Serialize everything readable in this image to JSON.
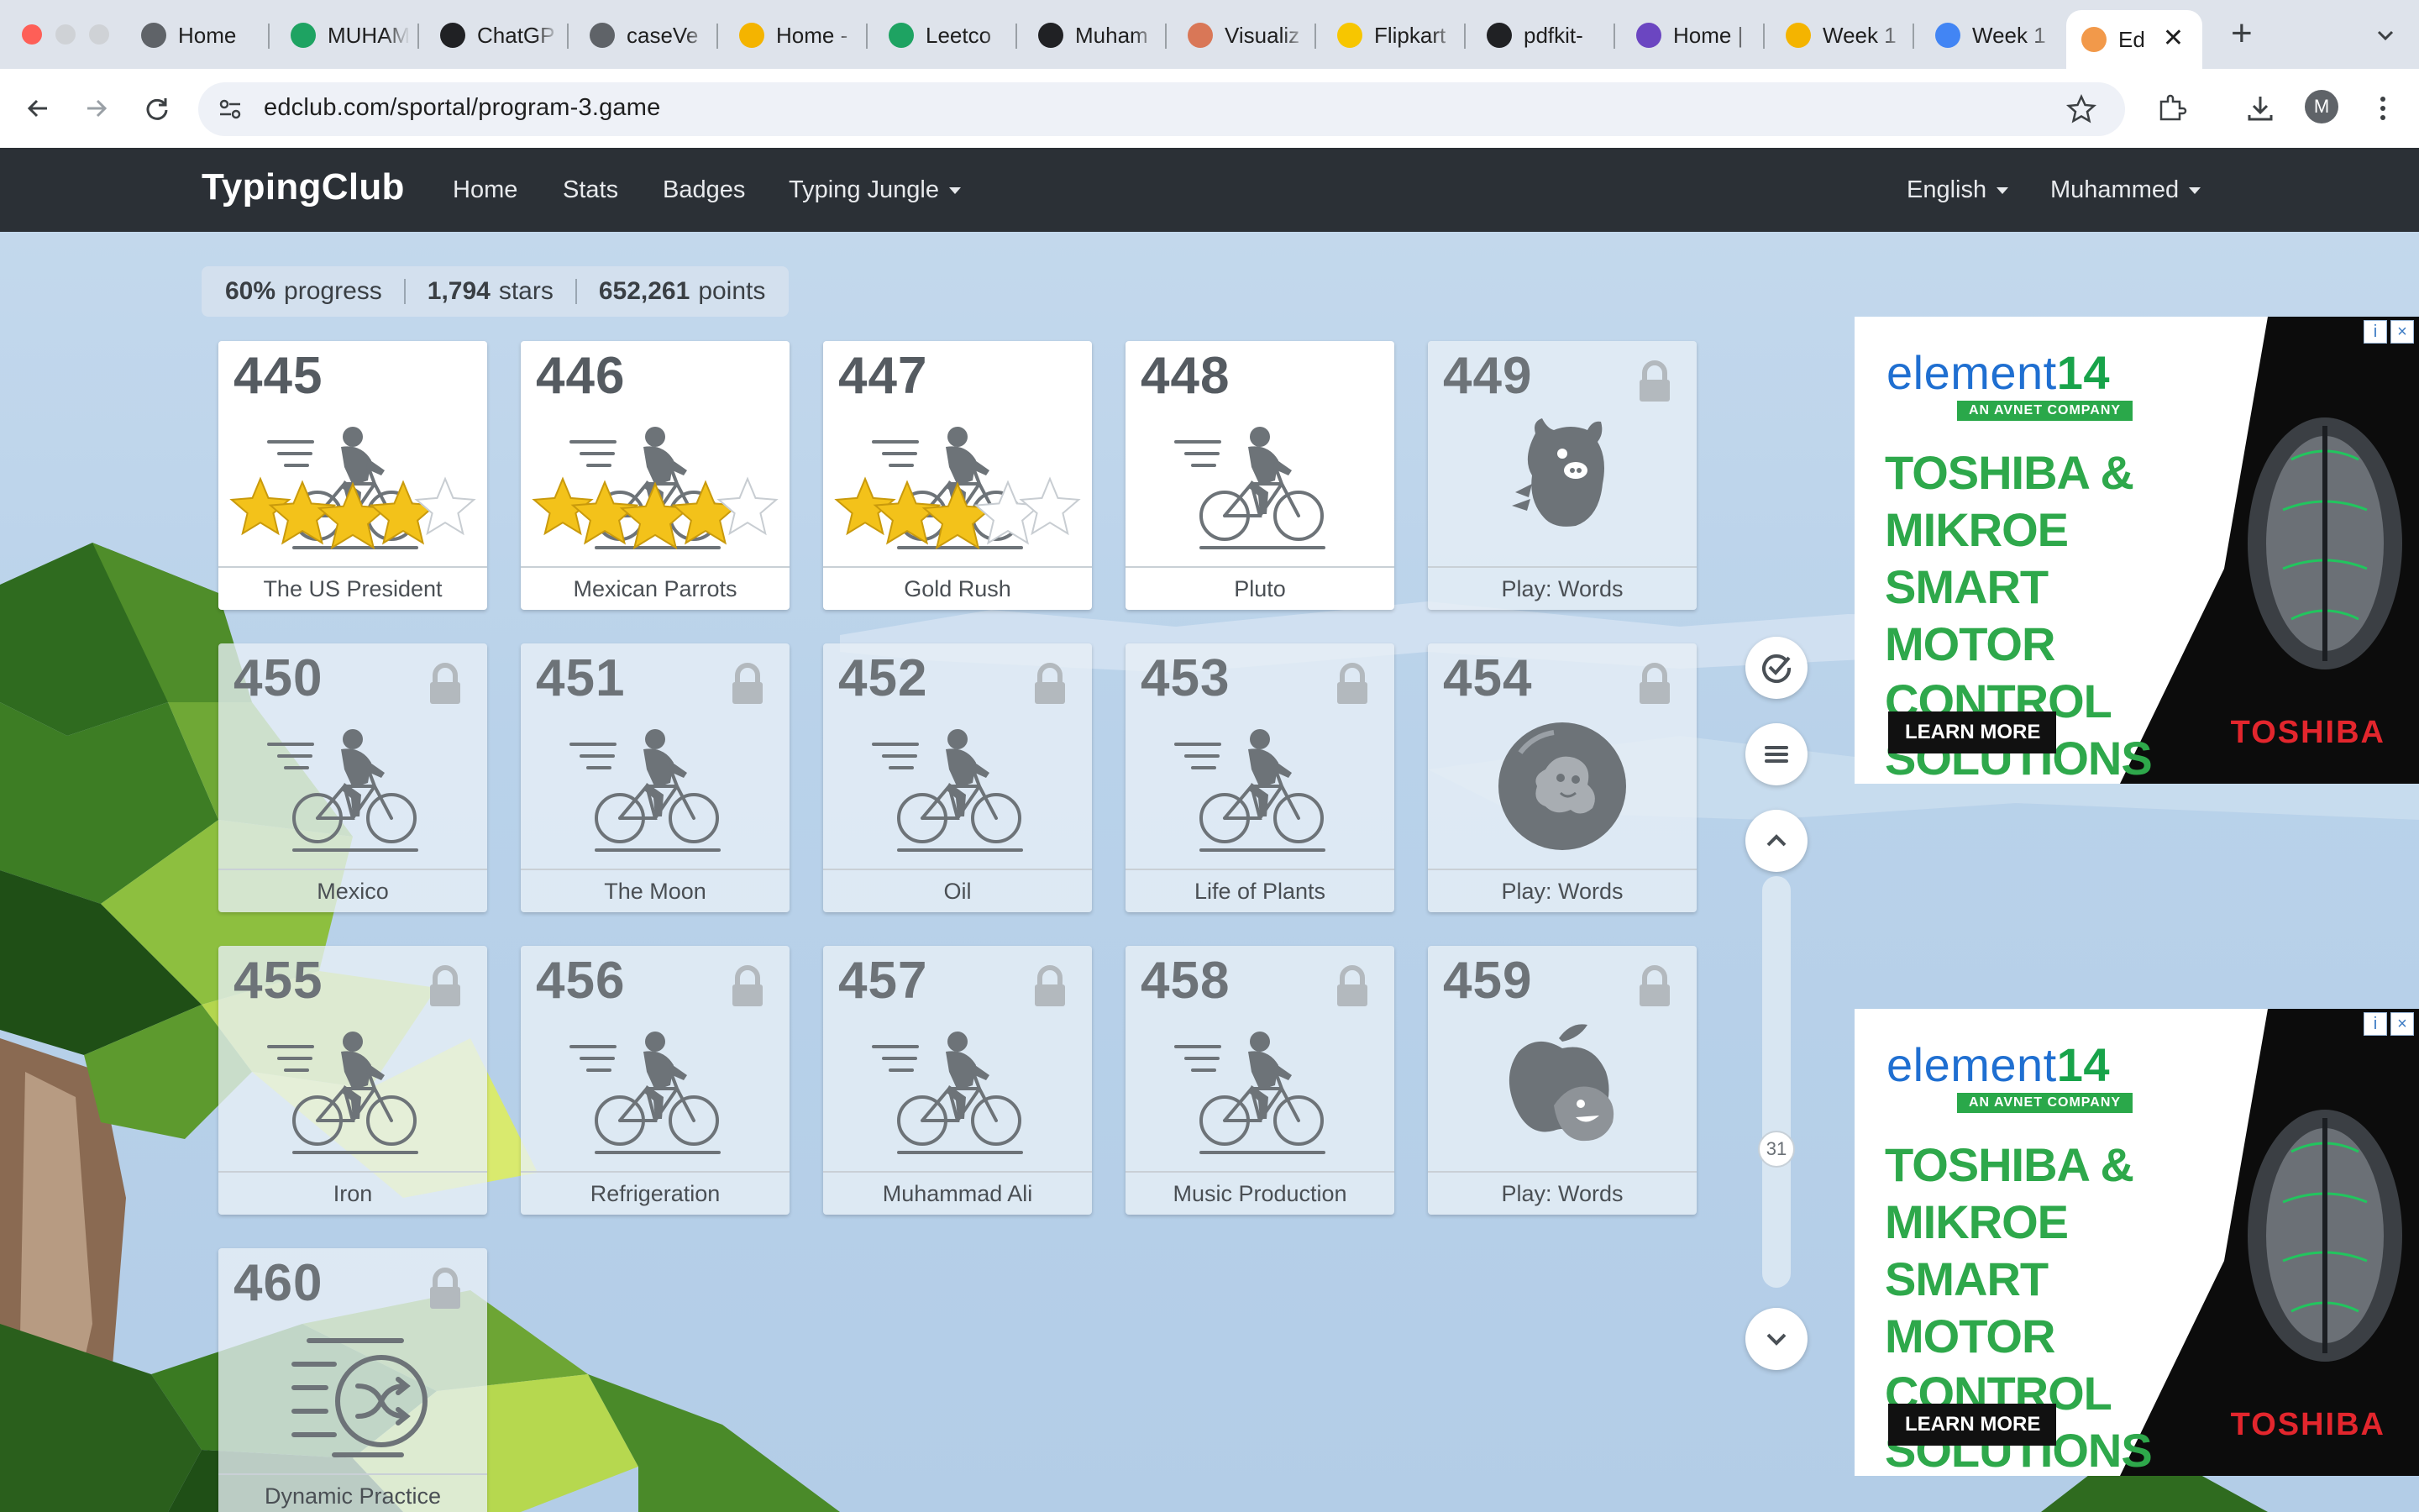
{
  "browser": {
    "tabs": [
      {
        "label": "Home",
        "favicon": "globe-icon",
        "color": "#5f6368"
      },
      {
        "label": "MUHAM",
        "favicon": "sheets-icon",
        "color": "#1ea362"
      },
      {
        "label": "ChatGP",
        "favicon": "chatgpt-icon",
        "color": "#202124"
      },
      {
        "label": "caseVe",
        "favicon": "globe-icon",
        "color": "#5f6368"
      },
      {
        "label": "Home -",
        "favicon": "drive-icon",
        "color": "#f4b400"
      },
      {
        "label": "Leetco",
        "favicon": "sheets-icon",
        "color": "#1ea362"
      },
      {
        "label": "Muham",
        "favicon": "leetcode-icon",
        "color": "#202124"
      },
      {
        "label": "Visualiz",
        "favicon": "claude-icon",
        "color": "#d97757"
      },
      {
        "label": "Flipkart",
        "favicon": "flipkart-icon",
        "color": "#f7c600"
      },
      {
        "label": "pdfkit-",
        "favicon": "github-icon",
        "color": "#202124"
      },
      {
        "label": "Home |",
        "favicon": "hackmd-icon",
        "color": "#6b46c1"
      },
      {
        "label": "Week 1",
        "favicon": "drive-icon",
        "color": "#f4b400"
      },
      {
        "label": "Week 1",
        "favicon": "docs-icon",
        "color": "#4285f4"
      },
      {
        "label": "Ed",
        "favicon": "edclub-icon",
        "color": "#f2994a"
      }
    ],
    "url": "edclub.com/sportal/program-3.game",
    "profile_initial": "M"
  },
  "site": {
    "brand": "TypingClub",
    "nav": {
      "home": "Home",
      "stats": "Stats",
      "badges": "Badges",
      "jungle": "Typing Jungle",
      "language": "English",
      "user": "Muhammed"
    }
  },
  "stats": {
    "progress_value": "60%",
    "progress_label": "progress",
    "stars_value": "1,794",
    "stars_label": "stars",
    "points_value": "652,261",
    "points_label": "points"
  },
  "lessons": [
    {
      "number": "445",
      "title": "The US President",
      "status": "completed",
      "stars": 4,
      "icon": "cyclist-icon"
    },
    {
      "number": "446",
      "title": "Mexican Parrots",
      "status": "completed",
      "stars": 4,
      "icon": "cyclist-icon"
    },
    {
      "number": "447",
      "title": "Gold Rush",
      "status": "completed",
      "stars": 3,
      "icon": "cyclist-icon"
    },
    {
      "number": "448",
      "title": "Pluto",
      "status": "unlocked",
      "stars": 0,
      "icon": "cyclist-icon"
    },
    {
      "number": "449",
      "title": "Play: Words",
      "status": "locked",
      "stars": 0,
      "icon": "monster-game-icon"
    },
    {
      "number": "450",
      "title": "Mexico",
      "status": "locked",
      "stars": 0,
      "icon": "cyclist-icon"
    },
    {
      "number": "451",
      "title": "The Moon",
      "status": "locked",
      "stars": 0,
      "icon": "cyclist-icon"
    },
    {
      "number": "452",
      "title": "Oil",
      "status": "locked",
      "stars": 0,
      "icon": "cyclist-icon"
    },
    {
      "number": "453",
      "title": "Life of Plants",
      "status": "locked",
      "stars": 0,
      "icon": "cyclist-icon"
    },
    {
      "number": "454",
      "title": "Play: Words",
      "status": "locked",
      "stars": 0,
      "icon": "bubble-game-icon"
    },
    {
      "number": "455",
      "title": "Iron",
      "status": "locked",
      "stars": 0,
      "icon": "cyclist-icon"
    },
    {
      "number": "456",
      "title": "Refrigeration",
      "status": "locked",
      "stars": 0,
      "icon": "cyclist-icon"
    },
    {
      "number": "457",
      "title": "Muhammad Ali",
      "status": "locked",
      "stars": 0,
      "icon": "cyclist-icon"
    },
    {
      "number": "458",
      "title": "Music Production",
      "status": "locked",
      "stars": 0,
      "icon": "cyclist-icon"
    },
    {
      "number": "459",
      "title": "Play: Words",
      "status": "locked",
      "stars": 0,
      "icon": "apple-game-icon"
    },
    {
      "number": "460",
      "title": "Dynamic Practice",
      "status": "locked",
      "stars": 0,
      "icon": "shuffle-practice-icon"
    }
  ],
  "sidebar": {
    "scroll_page": "31"
  },
  "ads": [
    {
      "logo_text": "element",
      "logo_num": "14",
      "tagline": "AN AVNET COMPANY",
      "headline": "TOSHIBA & MIKROE SMART MOTOR CONTROL SOLUTIONS",
      "cta": "LEARN MORE",
      "brand": "TOSHIBA"
    },
    {
      "logo_text": "element",
      "logo_num": "14",
      "tagline": "AN AVNET COMPANY",
      "headline": "TOSHIBA & MIKROE SMART MOTOR CONTROL SOLUTIONS",
      "cta": "LEARN MORE",
      "brand": "TOSHIBA"
    }
  ],
  "colors": {
    "nav_bg": "#2b3036",
    "sky": "#b9d2ea",
    "star_gold": "#f3c21a",
    "ad_green": "#2ea84b",
    "toshiba_red": "#e3262d"
  }
}
